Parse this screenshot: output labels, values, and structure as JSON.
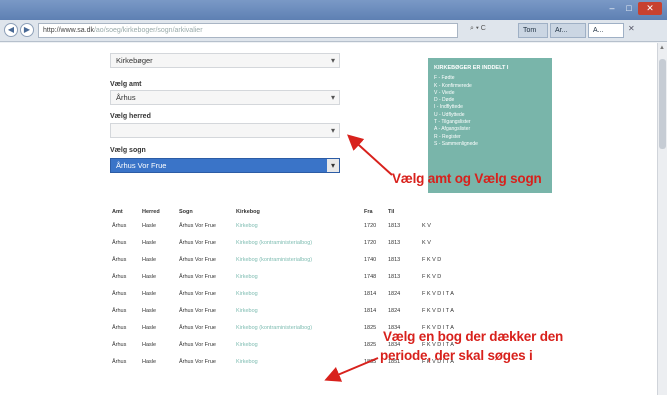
{
  "browser": {
    "window_controls": [
      "–",
      "□",
      "✕"
    ],
    "nav_back": "◀",
    "nav_fwd": "▶",
    "address_visible": "http://www.sa.dk",
    "address_rest": "/ao/soeg/kirkeboger/sogn/arkivalier",
    "address_icons": "⌕ ▾ C",
    "tabs": [
      {
        "label": "Tom"
      },
      {
        "label": "Ar..."
      },
      {
        "label": "A..."
      }
    ],
    "close_tab": "✕"
  },
  "scroll": {
    "up": "▲"
  },
  "form": {
    "top_select": {
      "value": "Kirkebøger",
      "chevron": "▾"
    },
    "amt": {
      "label": "Vælg amt",
      "value": "Århus",
      "chevron": "▾"
    },
    "herred": {
      "label": "Vælg herred",
      "value": "",
      "chevron": "▾"
    },
    "sogn": {
      "label": "Vælg sogn",
      "value": "Århus Vor Frue",
      "chevron": "▾"
    }
  },
  "infobox": {
    "title": "KIRKEBØGER ER INDDELT I",
    "lines": [
      "F - Fødte",
      "K - Konfirmerede",
      "V - Viede",
      "D - Døde",
      "I - Indflyttede",
      "U - Udflyttede",
      "T - Tilgangslister",
      "A - Afgangslister",
      "R - Register",
      "S - Sammenlignede"
    ]
  },
  "annotations": {
    "amt_sogn": "Vælg amt og Vælg sogn",
    "bog_line1": "Vælg en bog der dækker den",
    "bog_line2": "periode, der skal søges i"
  },
  "colors": {
    "annotation": "#d8211c",
    "infobox": "#79b5aa",
    "selected": "#3a74c8"
  },
  "table": {
    "headers": [
      "Amt",
      "Herred",
      "Sogn",
      "Kirkebog",
      "Fra",
      "Til",
      ""
    ],
    "rows": [
      [
        "Århus",
        "Hasle",
        "Århus Vor Frue",
        "Kirkebog",
        "1720",
        "1813",
        "K  V"
      ],
      [
        "Århus",
        "Hasle",
        "Århus Vor Frue",
        "Kirkebog (kontraministerialbog)",
        "1720",
        "1813",
        "K  V"
      ],
      [
        "Århus",
        "Hasle",
        "Århus Vor Frue",
        "Kirkebog (kontraministerialbog)",
        "1740",
        "1813",
        "F  K  V  D"
      ],
      [
        "Århus",
        "Hasle",
        "Århus Vor Frue",
        "Kirkebog",
        "1748",
        "1813",
        "F  K  V  D"
      ],
      [
        "Århus",
        "Hasle",
        "Århus Vor Frue",
        "Kirkebog",
        "1814",
        "1824",
        "F  K  V  D  I  T  A"
      ],
      [
        "Århus",
        "Hasle",
        "Århus Vor Frue",
        "Kirkebog",
        "1814",
        "1824",
        "F  K  V  D  I  T  A"
      ],
      [
        "Århus",
        "Hasle",
        "Århus Vor Frue",
        "Kirkebog (kontraministerialbog)",
        "1825",
        "1834",
        "F  K  V  D  I  T  A"
      ],
      [
        "Århus",
        "Hasle",
        "Århus Vor Frue",
        "Kirkebog",
        "1825",
        "1834",
        "F  K  V  D  I  T  A"
      ],
      [
        "Århus",
        "Hasle",
        "Århus Vor Frue",
        "Kirkebog",
        "1835",
        "1851",
        "F  K  V  D  I  T  A"
      ]
    ]
  }
}
